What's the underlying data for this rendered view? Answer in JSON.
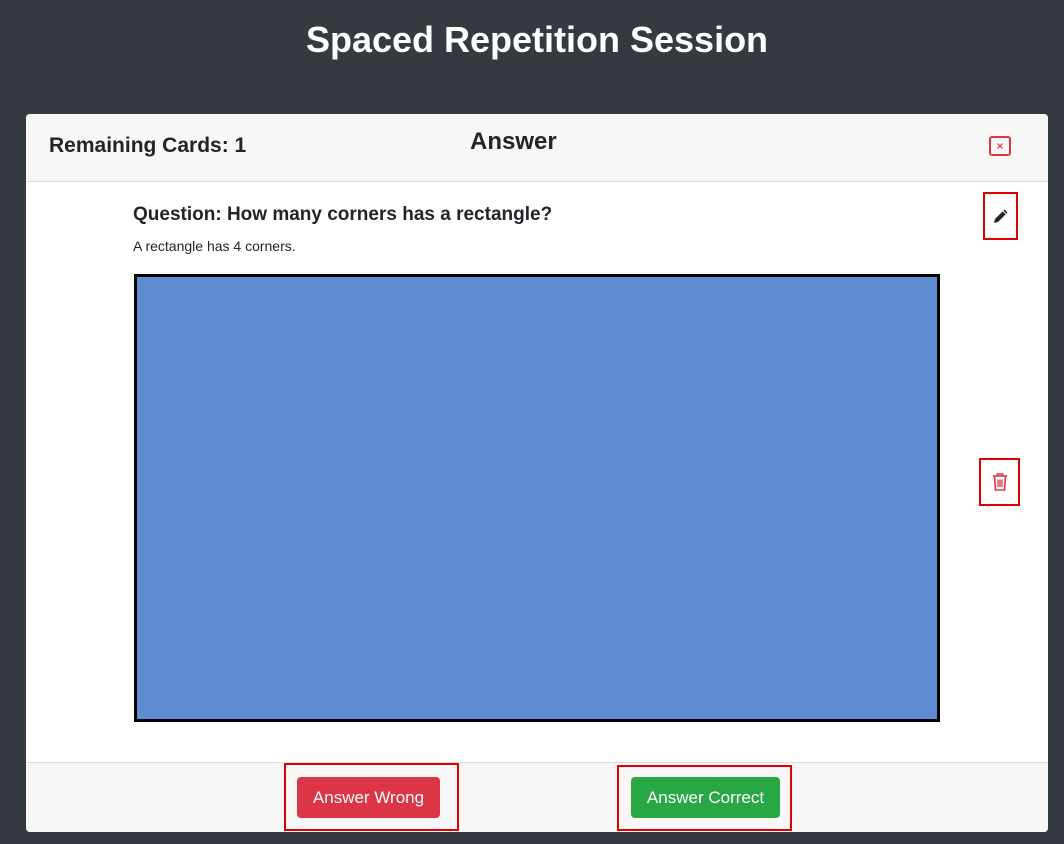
{
  "page": {
    "title": "Spaced Repetition Session"
  },
  "header": {
    "remaining_label": "Remaining Cards: 1",
    "heading": "Answer",
    "close_icon": "close-icon"
  },
  "card": {
    "question": "Question: How many corners has a rectangle?",
    "answer": "A rectangle has 4 corners.",
    "image_color": "#5f8bd3"
  },
  "actions": {
    "edit_icon": "pencil-icon",
    "delete_icon": "trash-icon"
  },
  "footer": {
    "wrong_label": "Answer Wrong",
    "correct_label": "Answer Correct"
  },
  "colors": {
    "background": "#343a40",
    "danger": "#dc3545",
    "success": "#28a745",
    "highlight": "#e00000"
  }
}
